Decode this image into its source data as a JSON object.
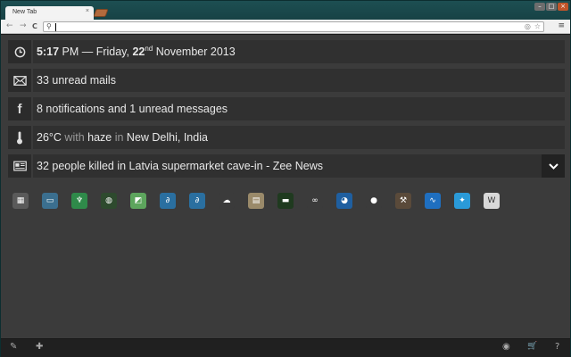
{
  "browser": {
    "tab_title": "New Tab",
    "tab_close": "×",
    "win_minimize": "–",
    "win_maximize": "□",
    "win_close": "×",
    "back": "←",
    "forward": "→",
    "reload": "C",
    "menu": "≡",
    "omnibox_value": ""
  },
  "rows": {
    "clock": {
      "time": "5:17",
      "ampm": " PM — Friday, ",
      "day": "22",
      "day_suffix": "nd",
      "month_year": " November 2013"
    },
    "mail": {
      "text": "33 unread mails"
    },
    "facebook": {
      "text": "8 notifications and 1 unread messages"
    },
    "weather": {
      "temp": "26°C",
      "with": " with ",
      "condition": "haze",
      "in": " in ",
      "location": "New Delhi, India"
    },
    "news": {
      "text": "32 people killed in Latvia supermarket cave-in - Zee News"
    }
  },
  "colors": {
    "titlebar": "#1d4f52",
    "content_bg": "#3b3b3b",
    "row_bg": "#303030",
    "accent_tab": "#b26a3d"
  },
  "apps": [
    {
      "name": "calculator-app",
      "glyph": "▦",
      "bg": "#5a5a5a"
    },
    {
      "name": "photo-app",
      "glyph": "▭",
      "bg": "#3b6f8f"
    },
    {
      "name": "evernote-web-app",
      "glyph": "♆",
      "bg": "#2f8a4a"
    },
    {
      "name": "globe-app",
      "glyph": "◍",
      "bg": "#2e4a2e"
    },
    {
      "name": "maps-app",
      "glyph": "◩",
      "bg": "#5da55d"
    },
    {
      "name": "chart-app-1",
      "glyph": "∂",
      "bg": "#2a6fa0"
    },
    {
      "name": "chart-app-2",
      "glyph": "∂",
      "bg": "#2a6fa0"
    },
    {
      "name": "cloud-app",
      "glyph": "☁",
      "bg": "#3b3b3b"
    },
    {
      "name": "spreadsheet-app",
      "glyph": "▤",
      "bg": "#9a8a6a"
    },
    {
      "name": "terminal-app",
      "glyph": "▬",
      "bg": "#1f3a1f"
    },
    {
      "name": "infinity-app",
      "glyph": "∞",
      "bg": "#3b3b3b"
    },
    {
      "name": "earth-app",
      "glyph": "◕",
      "bg": "#1f5fa0"
    },
    {
      "name": "tennis-app",
      "glyph": "●",
      "bg": "#3b3b3b"
    },
    {
      "name": "tool-app",
      "glyph": "⚒",
      "bg": "#5a4a3a"
    },
    {
      "name": "wave-app",
      "glyph": "∿",
      "bg": "#1f6fc0"
    },
    {
      "name": "twitter-app",
      "glyph": "✦",
      "bg": "#2a9ad8"
    },
    {
      "name": "word-app",
      "glyph": "W",
      "bg": "#d8d8d8"
    }
  ],
  "bottom": {
    "edit": "✎",
    "add": "✚",
    "theme": "◉",
    "store": "🛒",
    "help": "?"
  }
}
